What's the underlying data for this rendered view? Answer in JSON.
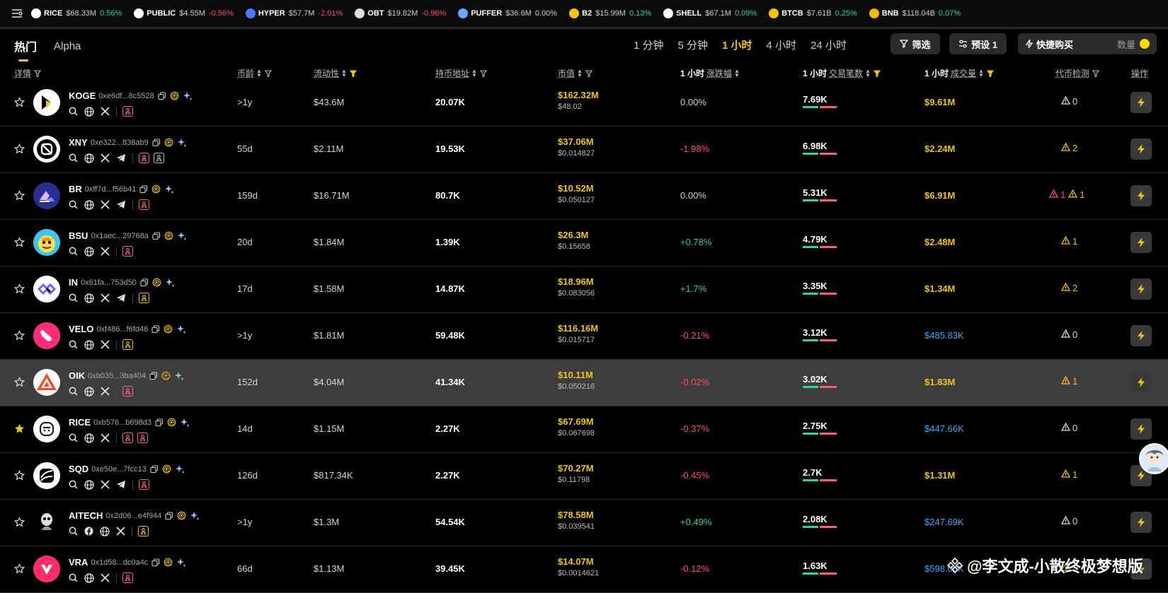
{
  "ticker": [
    {
      "sym": "RICE",
      "cap": "$68.33M",
      "chg": "0.56%",
      "dir": "pos",
      "color": "#ffffff"
    },
    {
      "sym": "PUBLIC",
      "cap": "$4.55M",
      "chg": "-0.56%",
      "dir": "neg",
      "color": "#ffffff"
    },
    {
      "sym": "HYPER",
      "cap": "$57.7M",
      "chg": "-2.01%",
      "dir": "neg",
      "color": "#4a7bff"
    },
    {
      "sym": "OBT",
      "cap": "$19.82M",
      "chg": "-0.96%",
      "dir": "neg",
      "color": "#dddddd"
    },
    {
      "sym": "PUFFER",
      "cap": "$36.6M",
      "chg": "0.00%",
      "dir": "neu",
      "color": "#6aa8ff"
    },
    {
      "sym": "B2",
      "cap": "$15.99M",
      "chg": "0.13%",
      "dir": "pos",
      "color": "#f0c419"
    },
    {
      "sym": "SHELL",
      "cap": "$67.1M",
      "chg": "0.09%",
      "dir": "pos",
      "color": "#ffffff"
    },
    {
      "sym": "BTCB",
      "cap": "$7.61B",
      "chg": "0.25%",
      "dir": "pos",
      "color": "#f5c400"
    },
    {
      "sym": "BNB",
      "cap": "$118.04B",
      "chg": "0.07%",
      "dir": "pos",
      "color": "#f0b90b"
    }
  ],
  "tabs": [
    "热门",
    "Alpha"
  ],
  "times": [
    "1 分钟",
    "5 分钟",
    "1 小时",
    "4 小时",
    "24 小时"
  ],
  "buttons": {
    "filter": "筛选",
    "preset": "预设 1",
    "quick_buy": "快捷购买",
    "quantity": "数量"
  },
  "columns": {
    "detail": "详情",
    "age": "币龄",
    "liquidity": "流动性",
    "holders": "持币地址",
    "mcap": "市值",
    "change_prefix": "1 小时",
    "change": "涨跌幅",
    "tx_prefix": "1 小时",
    "tx": "交易笔数",
    "vol_prefix": "1 小时",
    "vol": "成交量",
    "risk": "代币检测",
    "action": "操作"
  },
  "rows": [
    {
      "sym": "KOGE",
      "addr": "0xe6df...8c5528",
      "age": ">1y",
      "liq": "$43.6M",
      "holders": "20.07K",
      "mcap": "$162.32M",
      "price": "$48.02",
      "chg": "0.00%",
      "dir": "neu",
      "tx": "7.69K",
      "buy": 0.45,
      "vol": "$9.61M",
      "vc": "y",
      "risk": [
        {
          "c": "g",
          "n": "0"
        }
      ],
      "avatar": "#ffffff",
      "star": false,
      "tg": false,
      "hl": false
    },
    {
      "sym": "XNY",
      "addr": "0xe322...838ab9",
      "age": "55d",
      "liq": "$2.11M",
      "holders": "19.53K",
      "mcap": "$37.06M",
      "price": "$0.014827",
      "chg": "-1.98%",
      "dir": "neg",
      "tx": "6.98K",
      "buy": 0.45,
      "vol": "$2.24M",
      "vc": "y",
      "risk": [
        {
          "c": "y",
          "n": "2"
        }
      ],
      "avatar": "#ffffff",
      "star": false,
      "tg": true,
      "hl": false
    },
    {
      "sym": "BR",
      "addr": "0xff7d...f56b41",
      "age": "159d",
      "liq": "$16.71M",
      "holders": "80.7K",
      "mcap": "$10.52M",
      "price": "$0.050127",
      "chg": "0.00%",
      "dir": "neu",
      "tx": "5.31K",
      "buy": 0.45,
      "vol": "$6.91M",
      "vc": "y",
      "risk": [
        {
          "c": "r",
          "n": "1"
        },
        {
          "c": "y",
          "n": "1"
        }
      ],
      "avatar": "#2a2f8f",
      "star": false,
      "tg": true,
      "hl": false
    },
    {
      "sym": "BSU",
      "addr": "0x1aec...29768a",
      "age": "20d",
      "liq": "$1.84M",
      "holders": "1.39K",
      "mcap": "$26.3M",
      "price": "$0.15658",
      "chg": "+0.78%",
      "dir": "pos",
      "tx": "4.79K",
      "buy": 0.45,
      "vol": "$2.48M",
      "vc": "y",
      "risk": [
        {
          "c": "y",
          "n": "1"
        }
      ],
      "avatar": "#3cc6ef",
      "star": false,
      "tg": false,
      "hl": false
    },
    {
      "sym": "IN",
      "addr": "0x61fa...753d50",
      "age": "17d",
      "liq": "$1.58M",
      "holders": "14.87K",
      "mcap": "$18.96M",
      "price": "$0.083056",
      "chg": "+1.7%",
      "dir": "pos",
      "tx": "3.35K",
      "buy": 0.45,
      "vol": "$1.34M",
      "vc": "y",
      "risk": [
        {
          "c": "y",
          "n": "2"
        }
      ],
      "avatar": "#ffffff",
      "star": false,
      "tg": true,
      "hl": false
    },
    {
      "sym": "VELO",
      "addr": "0xf486...f6fd46",
      "age": ">1y",
      "liq": "$1.81M",
      "holders": "59.48K",
      "mcap": "$116.16M",
      "price": "$0.015717",
      "chg": "-0.21%",
      "dir": "neg",
      "tx": "3.12K",
      "buy": 0.45,
      "vol": "$485.83K",
      "vc": "b",
      "risk": [
        {
          "c": "g",
          "n": "0"
        }
      ],
      "avatar": "#ff2d7a",
      "star": false,
      "tg": false,
      "hl": false
    },
    {
      "sym": "OIK",
      "addr": "0xb035...3ba404",
      "age": "152d",
      "liq": "$4.04M",
      "holders": "41.34K",
      "mcap": "$10.11M",
      "price": "$0.050216",
      "chg": "-0.02%",
      "dir": "neg",
      "tx": "3.02K",
      "buy": 0.45,
      "vol": "$1.83M",
      "vc": "y",
      "risk": [
        {
          "c": "y",
          "n": "1"
        }
      ],
      "avatar": "#ffffff",
      "star": false,
      "tg": false,
      "hl": true
    },
    {
      "sym": "RICE",
      "addr": "0xb576...b698d3",
      "age": "14d",
      "liq": "$1.15M",
      "holders": "2.27K",
      "mcap": "$67.69M",
      "price": "$0.067698",
      "chg": "-0.37%",
      "dir": "neg",
      "tx": "2.75K",
      "buy": 0.45,
      "vol": "$447.66K",
      "vc": "b",
      "risk": [
        {
          "c": "g",
          "n": "0"
        }
      ],
      "avatar": "#ffffff",
      "star": true,
      "tg": false,
      "hl": false
    },
    {
      "sym": "SQD",
      "addr": "0xe50e...7fcc13",
      "age": "126d",
      "liq": "$817.34K",
      "holders": "2.27K",
      "mcap": "$70.27M",
      "price": "$0.11798",
      "chg": "-0.45%",
      "dir": "neg",
      "tx": "2.7K",
      "buy": 0.45,
      "vol": "$1.31M",
      "vc": "y",
      "risk": [
        {
          "c": "y",
          "n": "1"
        }
      ],
      "avatar": "#ffffff",
      "star": false,
      "tg": true,
      "hl": false
    },
    {
      "sym": "AITECH",
      "addr": "0x2d06...e4f944",
      "age": ">1y",
      "liq": "$1.3M",
      "holders": "54.54K",
      "mcap": "$78.58M",
      "price": "$0.039541",
      "chg": "+0.49%",
      "dir": "pos",
      "tx": "2.08K",
      "buy": 0.45,
      "vol": "$247.69K",
      "vc": "b",
      "risk": [
        {
          "c": "g",
          "n": "0"
        }
      ],
      "avatar": "#000000",
      "star": false,
      "tg": false,
      "hl": false
    },
    {
      "sym": "VRA",
      "addr": "0x1d58...dc0a4c",
      "age": "66d",
      "liq": "$1.13M",
      "holders": "39.45K",
      "mcap": "$14.07M",
      "price": "$0.0014621",
      "chg": "-0.12%",
      "dir": "neg",
      "tx": "1.63K",
      "buy": 0.45,
      "vol": "$598.06K",
      "vc": "b",
      "risk": [
        {
          "c": "y",
          "n": "3"
        }
      ],
      "avatar": "#ff2d6a",
      "star": false,
      "tg": false,
      "hl": false
    }
  ],
  "watermark": "@李文成-小散终极梦想版",
  "colors": {
    "accent": "#f0c419",
    "up": "#2ed3a0",
    "down": "#ff4d6a",
    "link": "#3aa8ff"
  }
}
